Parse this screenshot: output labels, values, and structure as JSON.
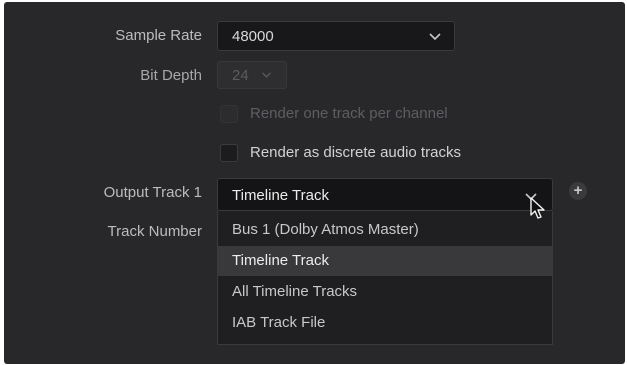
{
  "form": {
    "sample_rate": {
      "label": "Sample Rate",
      "value": "48000"
    },
    "bit_depth": {
      "label": "Bit Depth",
      "value": "24"
    },
    "render_per_channel": {
      "label": "Render one track per channel",
      "checked": false,
      "disabled": true
    },
    "render_discrete": {
      "label": "Render as discrete audio tracks",
      "checked": false,
      "disabled": false
    },
    "output_track": {
      "label": "Output Track 1",
      "value": "Timeline Track"
    },
    "track_number": {
      "label": "Track Number"
    }
  },
  "dropdown": {
    "options": [
      {
        "label": "Bus 1 (Dolby Atmos Master)"
      },
      {
        "label": "Timeline Track"
      },
      {
        "label": "All Timeline Tracks"
      },
      {
        "label": "IAB Track File"
      }
    ],
    "selected": "Timeline Track"
  },
  "icons": {
    "add": "plus-circle-icon",
    "chevron": "chevron-down-icon",
    "pointer": "mouse-pointer-icon"
  },
  "colors": {
    "panel": "#28282b",
    "field": "#18181a",
    "highlight": "#39393c"
  }
}
